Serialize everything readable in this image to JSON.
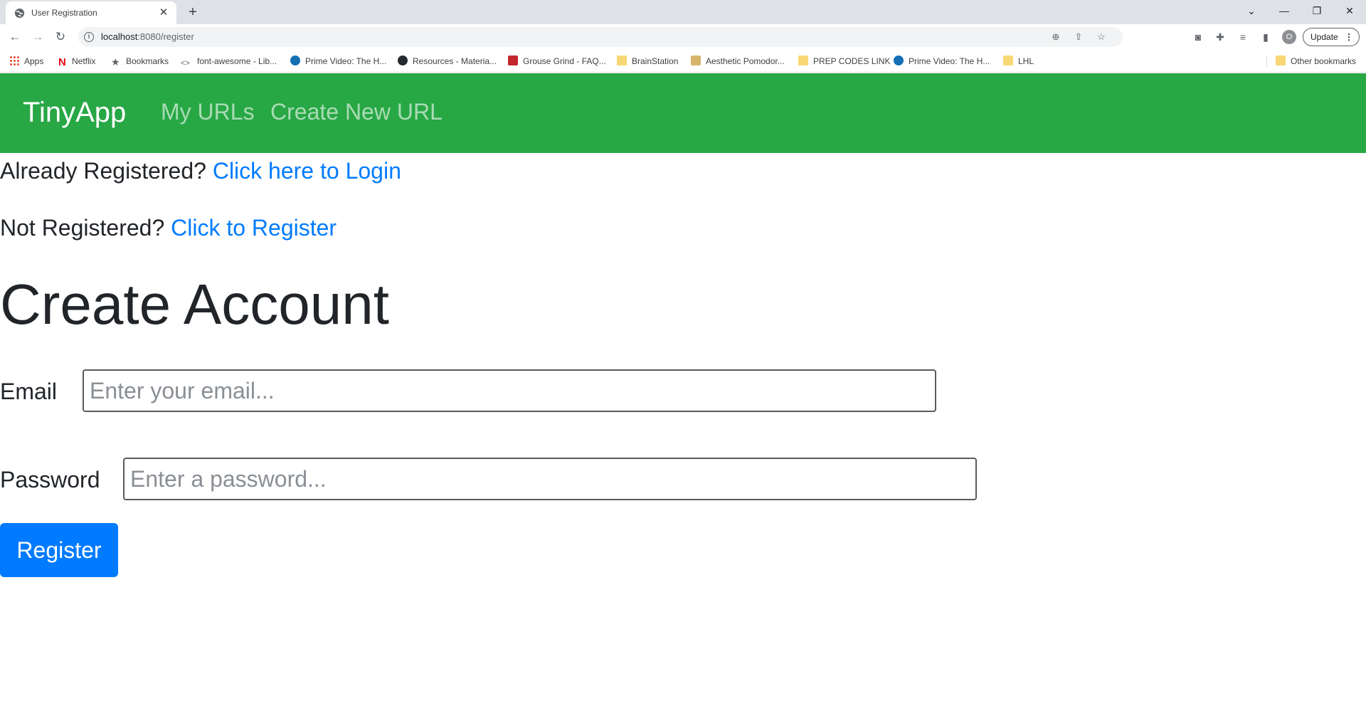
{
  "browser": {
    "tab_title": "User Registration",
    "new_tab_symbol": "+",
    "url_host": "localhost",
    "url_rest": ":8080/register",
    "update_label": "Update",
    "profile_initial": "O",
    "bookmarks": [
      {
        "label": "Apps",
        "icon": "apps-icon"
      },
      {
        "label": "Netflix",
        "icon": "netflix-icon"
      },
      {
        "label": "Bookmarks",
        "icon": "star-icon"
      },
      {
        "label": "font-awesome - Lib...",
        "icon": "code-icon"
      },
      {
        "label": "Prime Video: The H...",
        "icon": "prime-video-icon"
      },
      {
        "label": "Resources - Materia...",
        "icon": "github-icon"
      },
      {
        "label": "Grouse Grind - FAQ...",
        "icon": "grouse-grind-icon"
      },
      {
        "label": "BrainStation",
        "icon": "folder-icon"
      },
      {
        "label": "Aesthetic Pomodor...",
        "icon": "aesthetic-icon"
      },
      {
        "label": "PREP CODES LINK",
        "icon": "folder-icon"
      },
      {
        "label": "Prime Video: The H...",
        "icon": "prime-video-icon"
      },
      {
        "label": "LHL",
        "icon": "folder-icon"
      }
    ],
    "other_bookmarks": "Other bookmarks"
  },
  "navbar": {
    "brand": "TinyApp",
    "links": [
      "My URLs",
      "Create New URL"
    ]
  },
  "auth_prompts": {
    "already_registered": "Already Registered?",
    "login_link": "Click here to Login",
    "not_registered": "Not Registered?",
    "register_link": "Click to Register"
  },
  "form": {
    "heading": "Create Account",
    "email_label": "Email",
    "email_placeholder": "Enter your email...",
    "email_value": "",
    "password_label": "Password",
    "password_placeholder": "Enter a password...",
    "password_value": "",
    "submit_label": "Register"
  },
  "colors": {
    "navbar_bg": "#28a745",
    "link": "#007bff",
    "button_bg": "#007bff"
  }
}
